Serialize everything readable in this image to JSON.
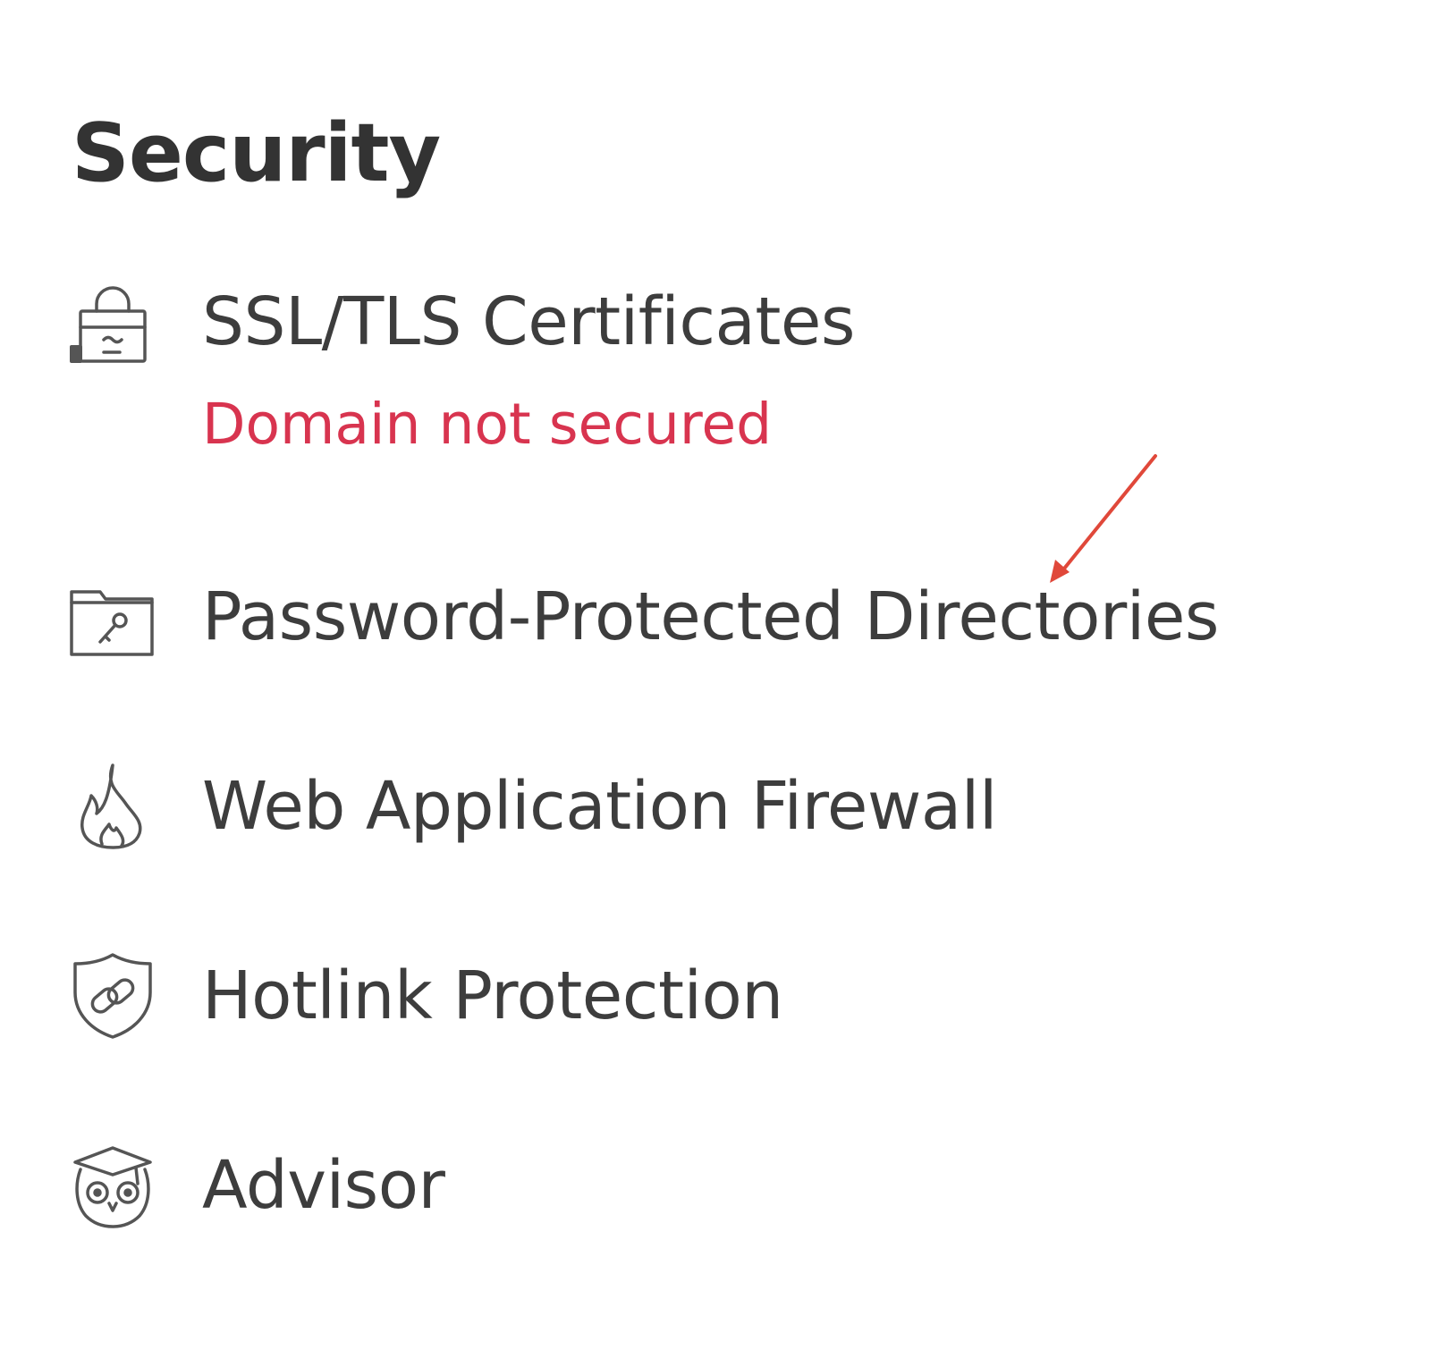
{
  "section": {
    "title": "Security"
  },
  "items": [
    {
      "id": "ssl",
      "label": "SSL/TLS Certificates",
      "icon": "lock-certificate-icon",
      "status": "Domain not secured",
      "status_color": "#d8344f"
    },
    {
      "id": "password-dirs",
      "label": "Password-Protected Directories",
      "icon": "folder-key-icon"
    },
    {
      "id": "waf",
      "label": "Web Application Firewall",
      "icon": "flame-icon"
    },
    {
      "id": "hotlink",
      "label": "Hotlink Protection",
      "icon": "shield-link-icon"
    },
    {
      "id": "advisor",
      "label": "Advisor",
      "icon": "owl-icon"
    }
  ],
  "colors": {
    "text": "#3d3d3d",
    "title": "#333333",
    "icon_stroke": "#555555",
    "annotation_arrow": "#e0483a"
  }
}
